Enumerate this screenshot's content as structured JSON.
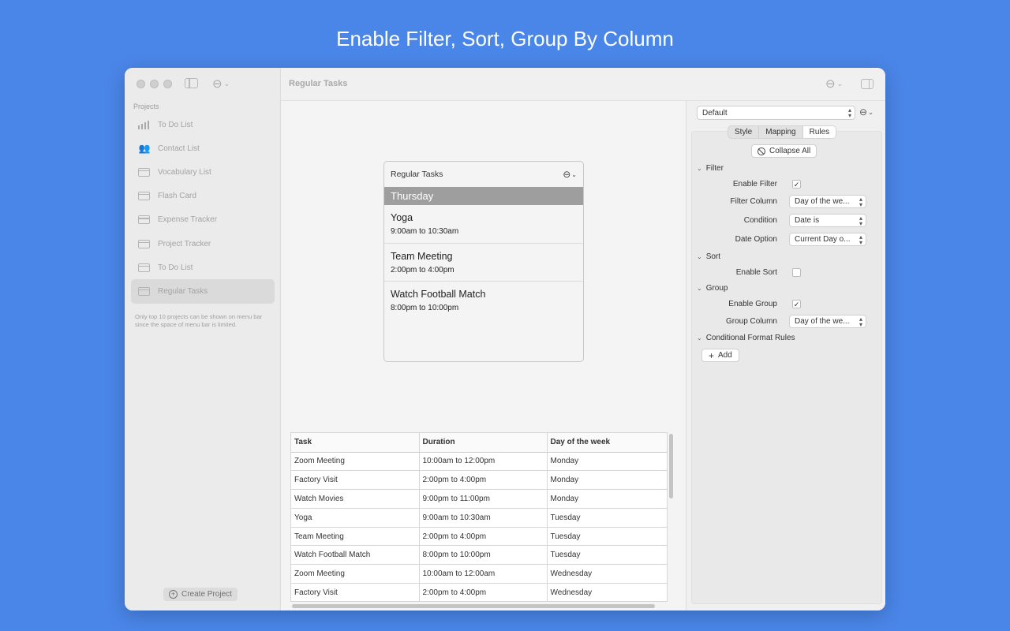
{
  "headline": "Enable Filter, Sort, Group By Column",
  "sidebar": {
    "projects_label": "Projects",
    "items": [
      {
        "label": "To Do List",
        "icon": "bar-chart-icon"
      },
      {
        "label": "Contact List",
        "icon": "people-icon"
      },
      {
        "label": "Vocabulary List",
        "icon": "folder-icon"
      },
      {
        "label": "Flash Card",
        "icon": "folder-icon"
      },
      {
        "label": "Expense Tracker",
        "icon": "folder-icon"
      },
      {
        "label": "Project Tracker",
        "icon": "folder-icon"
      },
      {
        "label": "To Do List",
        "icon": "folder-icon"
      },
      {
        "label": "Regular Tasks",
        "icon": "folder-icon",
        "selected": true
      }
    ],
    "note": "Only top 10 projects can be shown on menu bar since the space of menu bar is limited.",
    "create_button": "Create Project"
  },
  "toolbar": {
    "title": "Regular Tasks"
  },
  "preview": {
    "title": "Regular Tasks",
    "group": "Thursday",
    "items": [
      {
        "title": "Yoga",
        "time": "9:00am to 10:30am"
      },
      {
        "title": "Team Meeting",
        "time": "2:00pm to 4:00pm"
      },
      {
        "title": "Watch Football Match",
        "time": "8:00pm to 10:00pm"
      }
    ]
  },
  "table": {
    "headers": [
      "Task",
      "Duration",
      "Day of the week"
    ],
    "rows": [
      [
        "Zoom Meeting",
        "10:00am to 12:00pm",
        "Monday"
      ],
      [
        "Factory Visit",
        "2:00pm to 4:00pm",
        "Monday"
      ],
      [
        "Watch Movies",
        "9:00pm to 11:00pm",
        "Monday"
      ],
      [
        "Yoga",
        "9:00am to 10:30am",
        "Tuesday"
      ],
      [
        "Team Meeting",
        "2:00pm to 4:00pm",
        "Tuesday"
      ],
      [
        "Watch Football Match",
        "8:00pm to 10:00pm",
        "Tuesday"
      ],
      [
        "Zoom Meeting",
        "10:00am to 12:00am",
        "Wednesday"
      ],
      [
        "Factory Visit",
        "2:00pm to 4:00pm",
        "Wednesday"
      ]
    ]
  },
  "inspector": {
    "preset": "Default",
    "tabs": [
      "Style",
      "Mapping",
      "Rules"
    ],
    "active_tab": "Rules",
    "collapse_all": "Collapse All",
    "filter": {
      "section": "Filter",
      "enable_label": "Enable Filter",
      "enabled": true,
      "column_label": "Filter Column",
      "column_value": "Day of the we...",
      "condition_label": "Condition",
      "condition_value": "Date is",
      "date_option_label": "Date Option",
      "date_option_value": "Current Day o..."
    },
    "sort": {
      "section": "Sort",
      "enable_label": "Enable Sort",
      "enabled": false
    },
    "group": {
      "section": "Group",
      "enable_label": "Enable Group",
      "enabled": true,
      "column_label": "Group Column",
      "column_value": "Day of the we..."
    },
    "conditional": {
      "section": "Conditional Format Rules",
      "add_label": "Add"
    }
  },
  "colors": {
    "background": "#4a86e8",
    "group_header": "#9e9e9e"
  }
}
